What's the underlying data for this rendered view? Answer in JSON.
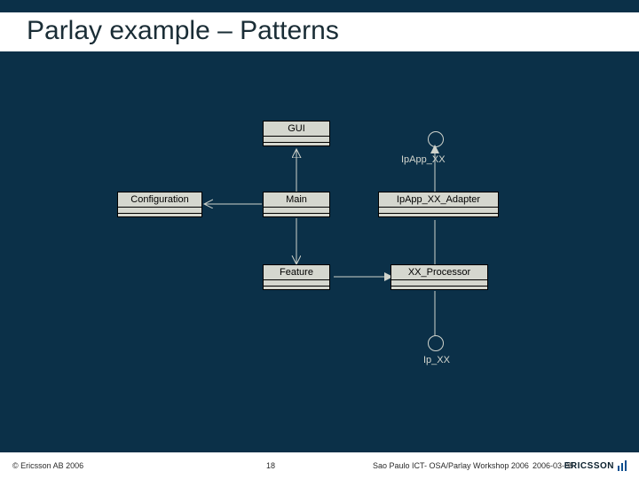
{
  "slide": {
    "title": "Parlay example – Patterns"
  },
  "diagram": {
    "classes": {
      "gui": {
        "name": "GUI"
      },
      "configuration": {
        "name": "Configuration"
      },
      "main": {
        "name": "Main"
      },
      "adapter": {
        "name": "IpApp_XX_Adapter"
      },
      "feature": {
        "name": "Feature"
      },
      "processor": {
        "name": "XX_Processor"
      }
    },
    "interfaces": {
      "ipapp_xx": {
        "label": "IpApp_XX"
      },
      "ip_xx": {
        "label": "Ip_XX"
      }
    }
  },
  "footer": {
    "copyright": "© Ericsson AB 2006",
    "page": "18",
    "event": "Sao Paulo ICT- OSA/Parlay Workshop 2006",
    "date": "2006-03-08",
    "brand": "ERICSSON"
  },
  "chart_data": {
    "type": "diagram",
    "title": "Parlay example – Patterns",
    "nodes": [
      {
        "id": "gui",
        "kind": "class",
        "label": "GUI"
      },
      {
        "id": "ipapp_xx",
        "kind": "interface",
        "label": "IpApp_XX"
      },
      {
        "id": "configuration",
        "kind": "class",
        "label": "Configuration"
      },
      {
        "id": "main",
        "kind": "class",
        "label": "Main"
      },
      {
        "id": "adapter",
        "kind": "class",
        "label": "IpApp_XX_Adapter"
      },
      {
        "id": "feature",
        "kind": "class",
        "label": "Feature"
      },
      {
        "id": "processor",
        "kind": "class",
        "label": "XX_Processor"
      },
      {
        "id": "ip_xx",
        "kind": "interface",
        "label": "Ip_XX"
      }
    ],
    "edges": [
      {
        "from": "main",
        "to": "gui",
        "type": "association-open"
      },
      {
        "from": "main",
        "to": "configuration",
        "type": "association-open"
      },
      {
        "from": "main",
        "to": "feature",
        "type": "association-open"
      },
      {
        "from": "adapter",
        "to": "ipapp_xx",
        "type": "realization"
      },
      {
        "from": "feature",
        "to": "adapter",
        "type": "dependency",
        "via": "processor"
      },
      {
        "from": "processor",
        "to": "adapter",
        "type": "association"
      },
      {
        "from": "processor",
        "to": "ip_xx",
        "type": "dependency"
      }
    ]
  }
}
